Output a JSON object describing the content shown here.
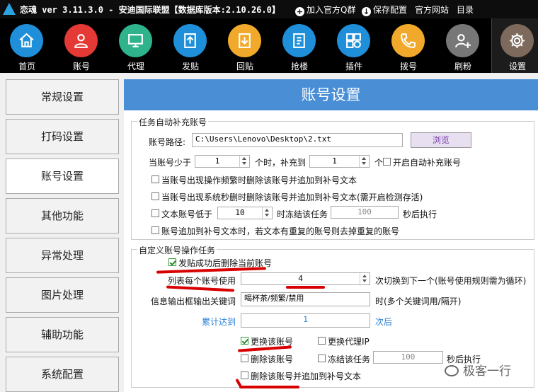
{
  "titlebar": {
    "title": "恋魂 ver 3.11.3.0 - 安迪国际联盟【数据库版本:2.10.26.0】",
    "links": [
      "加入官方Q群",
      "保存配置",
      "官方网站",
      "目录"
    ]
  },
  "toolbar": [
    {
      "label": "首页",
      "icon": "home-icon",
      "color": "#1e8fd8"
    },
    {
      "label": "账号",
      "icon": "user-icon",
      "color": "#e53935"
    },
    {
      "label": "代理",
      "icon": "monitor-icon",
      "color": "#2eb38d"
    },
    {
      "label": "发贴",
      "icon": "upload-icon",
      "color": "#1e8fd8"
    },
    {
      "label": "回贴",
      "icon": "download-icon",
      "color": "#f0a92a"
    },
    {
      "label": "抢楼",
      "icon": "floor-icon",
      "color": "#1e8fd8"
    },
    {
      "label": "插件",
      "icon": "plugin-icon",
      "color": "#1e8fd8"
    },
    {
      "label": "拨号",
      "icon": "phone-icon",
      "color": "#f0a92a"
    },
    {
      "label": "刷粉",
      "icon": "add-user-icon",
      "color": "#777777"
    },
    {
      "label": "设置",
      "icon": "gear-icon",
      "color": "#7d6a5d"
    }
  ],
  "sidebar": [
    "常规设置",
    "打码设置",
    "账号设置",
    "其他功能",
    "异常处理",
    "图片处理",
    "辅助功能",
    "系统配置"
  ],
  "main": {
    "header": "账号设置",
    "group1": {
      "title": "任务自动补充账号",
      "path_label": "账号路径:",
      "path_value": "C:\\Users\\Lenovo\\Desktop\\2.txt",
      "browse": "浏览",
      "less_label": "当账号少于",
      "less_value": "1",
      "hour_label": "个时，补充到",
      "fill_value": "1",
      "unit": "个",
      "auto_fill": "开启自动补充账号",
      "opt1": "当账号出现操作频繁时删除该账号并追加到补号文本",
      "opt2": "当账号出现系统秒删时删除该账号并追加到补号文本(需开启检测存活)",
      "opt3_label": "文本账号低于",
      "opt3_value": "10",
      "freeze_label": "时冻结该任务",
      "freeze_value": "100",
      "after_label": "秒后执行",
      "opt4": "账号追加到补号文本时，若文本有重复的账号则去掉重复的账号"
    },
    "group2": {
      "title": "自定义账号操作任务",
      "delete_after_post": "发贴成功后删除当前账号",
      "per_account_label": "列表每个账号使用",
      "per_account_value": "4",
      "per_account_suffix": "次切换到下一个(账号使用规则需为循环)",
      "keyword_label": "信息输出框输出关键词",
      "keyword_value": "喝杯茶/频繁/禁用",
      "keyword_suffix": "时(多个关键词用/隔开)",
      "accum_label": "累计达到",
      "accum_value": "1",
      "accum_suffix": "次后",
      "change_account": "更换该账号",
      "change_proxy": "更换代理IP",
      "delete_account": "删除该账号",
      "freeze_task": "冻结该任务",
      "freeze_value": "100",
      "after_exec": "秒后执行",
      "delete_append": "删除该账号并追加到补号文本"
    }
  },
  "watermark": "极客一行",
  "colors": {
    "header": "#4a8fd6",
    "accent_blue": "#2a7fd4",
    "mark_red": "#d90000"
  }
}
